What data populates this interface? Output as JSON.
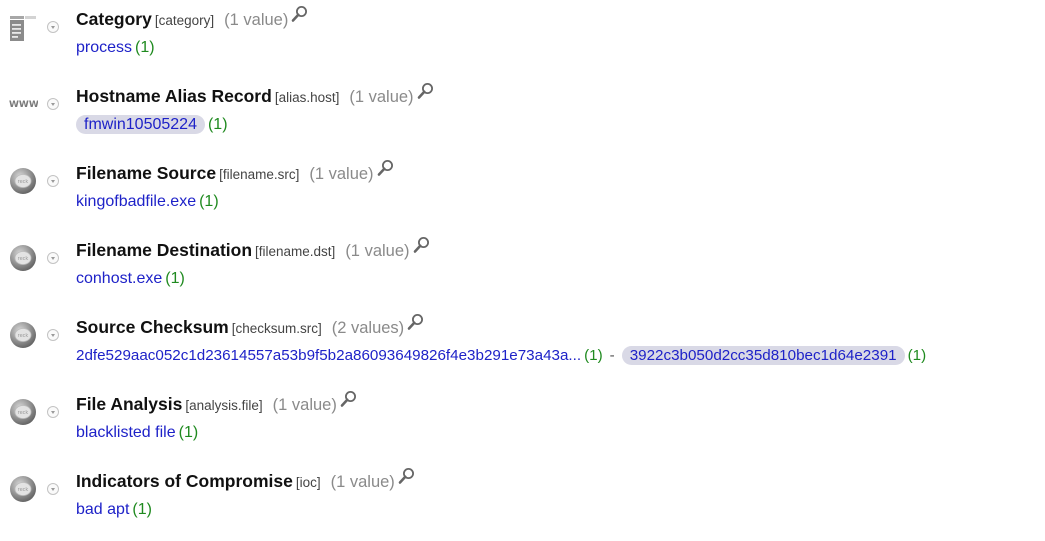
{
  "metas": [
    {
      "name": "Category",
      "key": "[category]",
      "count": "(1 value)",
      "icon": "category-icon",
      "values": [
        {
          "text": "process",
          "count": "(1)",
          "selected": false
        }
      ]
    },
    {
      "name": "Hostname Alias Record",
      "key": "[alias.host]",
      "count": "(1 value)",
      "icon": "www-icon",
      "values": [
        {
          "text": "fmwin10505224",
          "count": "(1)",
          "selected": true
        }
      ]
    },
    {
      "name": "Filename Source",
      "key": "[filename.src]",
      "count": "(1 value)",
      "icon": "meta-disc-icon",
      "values": [
        {
          "text": "kingofbadfile.exe",
          "count": "(1)",
          "selected": false
        }
      ]
    },
    {
      "name": "Filename Destination",
      "key": "[filename.dst]",
      "count": "(1 value)",
      "icon": "meta-disc-icon",
      "values": [
        {
          "text": "conhost.exe",
          "count": "(1)",
          "selected": false
        }
      ]
    },
    {
      "name": "Source Checksum",
      "key": "[checksum.src]",
      "count": "(2 values)",
      "icon": "meta-disc-icon",
      "values": [
        {
          "text": "2dfe529aac052c1d23614557a53b9f5b2a86093649826f4e3b291e73a43a...",
          "count": "(1)",
          "selected": false
        },
        {
          "text": "3922c3b050d2cc35d810bec1d64e2391",
          "count": "(1)",
          "selected": true
        }
      ],
      "separator": "-"
    },
    {
      "name": "File Analysis",
      "key": "[analysis.file]",
      "count": "(1 value)",
      "icon": "meta-disc-icon",
      "values": [
        {
          "text": "blacklisted file",
          "count": "(1)",
          "selected": false
        }
      ]
    },
    {
      "name": "Indicators of Compromise",
      "key": "[ioc]",
      "count": "(1 value)",
      "icon": "meta-disc-icon",
      "values": [
        {
          "text": "bad apt",
          "count": "(1)",
          "selected": false
        }
      ]
    }
  ],
  "icon_labels": {
    "www": "WWW",
    "disc": "reck"
  },
  "colors": {
    "value_link": "#1e22c8",
    "value_count": "#1f8a1f",
    "selected_pill": "#d9d9e6",
    "muted": "#8a8a8a"
  }
}
